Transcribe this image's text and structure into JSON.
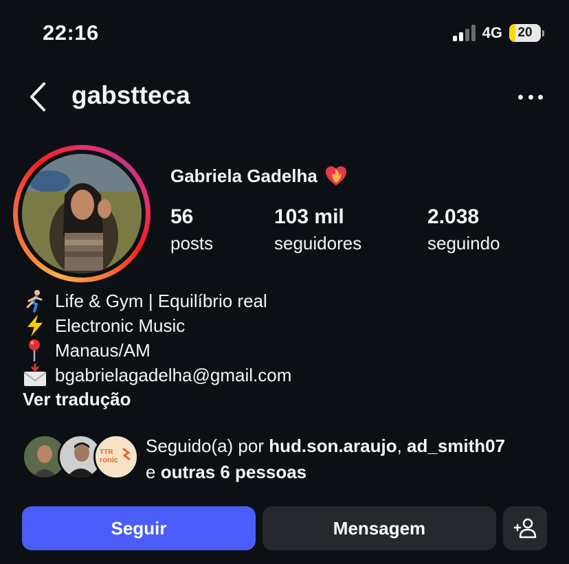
{
  "status_bar": {
    "time": "22:16",
    "network": "4G",
    "battery": "20",
    "battery_color": "#ffd60a"
  },
  "header": {
    "username": "gabstteca",
    "back_icon": "chevron-left-icon",
    "more_icon": "more-horizontal-icon"
  },
  "profile": {
    "full_name": "Gabriela Gadelha",
    "name_emoji": "heart-on-fire-icon",
    "ring_colors": [
      "#fcaf45",
      "#fd1d1d",
      "#c13584"
    ]
  },
  "stats": [
    {
      "value": "56",
      "label": "posts"
    },
    {
      "value": "103 mil",
      "label": "seguidores"
    },
    {
      "value": "2.038",
      "label": "seguindo"
    }
  ],
  "bio": {
    "lines": [
      {
        "icon": "running-person-icon",
        "text": "Life & Gym | Equilíbrio real"
      },
      {
        "icon": "lightning-icon",
        "text": "Electronic Music"
      },
      {
        "icon": "pin-icon",
        "text": "Manaus/AM"
      },
      {
        "icon": "envelope-icon",
        "text": "bgabrielagadelha@gmail.com"
      }
    ],
    "translate": "Ver tradução"
  },
  "followed_by": {
    "prefix": "Seguido(a) por ",
    "user1": "hud.son.araujo",
    "sep": ", ",
    "user2": "ad_smith07",
    "middle": "e ",
    "others": "outras 6 pessoas",
    "avatar3_text_top": "TTR",
    "avatar3_text_mid": "ronic"
  },
  "actions": {
    "follow": "Seguir",
    "message": "Mensagem",
    "add_icon": "add-person-icon",
    "follow_color": "#4a5df9"
  }
}
